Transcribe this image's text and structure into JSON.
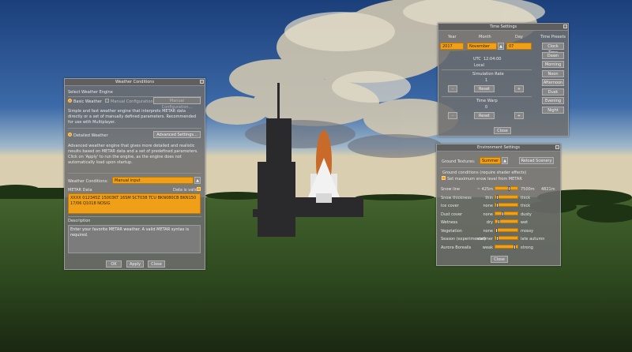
{
  "weather": {
    "title": "Weather Conditions",
    "select_engine": "Select Weather Engine",
    "basic_label": "Basic Weather",
    "manual_label": "Manual Configuration",
    "manual_btn": "Manual Configuration...",
    "basic_desc": "Simple and fast weather engine that interprets METAR data directly or a set of manually defined parameters. Recommended for use with Multiplayer.",
    "detailed_label": "Detailed Weather",
    "advanced_btn": "Advanced Settings...",
    "detailed_desc": "Advanced weather engine that gives more detailed and realistic results based on METAR data and a set of predefined parameters. Click on 'Apply' to run the engine, as the engine does not automatically load upon startup.",
    "conditions_label": "Weather Conditions:",
    "conditions_value": "Manual input",
    "metar_label": "METAR Data",
    "metar_valid": "Data is valid",
    "metar_text": "XXXX 012345Z 15003KT 16SM SCT038 TCU BKN080CB BKN150 17/06 Q1018 NOSIG",
    "description_label": "Description",
    "description_text": "Enter your favorite METAR weather. A valid METAR syntax is required.",
    "ok": "OK",
    "apply": "Apply",
    "close": "Close"
  },
  "time": {
    "title": "Time Settings",
    "year_label": "Year",
    "month_label": "Month",
    "day_label": "Day",
    "year": "2017",
    "month": "November",
    "day": "07",
    "utc_label": "UTC",
    "utc_value": "12:04:00",
    "local_label": "Local",
    "sim_rate_label": "Simulation Rate",
    "sim_rate": "1",
    "time_warp_label": "Time Warp",
    "time_warp": "0",
    "minus": "-",
    "plus": "+",
    "reset": "Reset",
    "close": "Close",
    "presets_label": "Time Presets",
    "presets": [
      "Clock Time",
      "Dawn",
      "Morning",
      "Noon",
      "Afternoon",
      "Dusk",
      "Evening",
      "Night"
    ]
  },
  "env": {
    "title": "Environment Settings",
    "ground_textures_label": "Ground Textures:",
    "ground_textures_value": "Summer",
    "reload_btn": "Reload Scenery",
    "ground_conditions": "Ground conditions (require shader effects)",
    "max_snow_label": "Set maximum snow level from METAR",
    "rows": [
      {
        "label": "Snow line",
        "low": "~ 425m",
        "high": "7500m",
        "value": "4821m",
        "level": 0.6
      },
      {
        "label": "Snow thickness",
        "low": "thin",
        "high": "thick",
        "value": "",
        "level": 0.05
      },
      {
        "label": "Ice cover",
        "low": "none",
        "high": "thick",
        "value": "",
        "level": 0.05
      },
      {
        "label": "Dust cover",
        "low": "none",
        "high": "dusty",
        "value": "",
        "level": 0.3
      },
      {
        "label": "Wetness",
        "low": "dry",
        "high": "wet",
        "value": "",
        "level": 0.1
      },
      {
        "label": "Vegetation",
        "low": "none",
        "high": "mossy",
        "value": "",
        "level": 0.0
      },
      {
        "label": "Season (experimental)",
        "low": "summer",
        "high": "late autumn",
        "value": "",
        "level": 0.05
      },
      {
        "label": "Aurora Borealis",
        "low": "weak",
        "high": "strong",
        "value": "",
        "level": 0.9
      }
    ],
    "close": "Close"
  }
}
